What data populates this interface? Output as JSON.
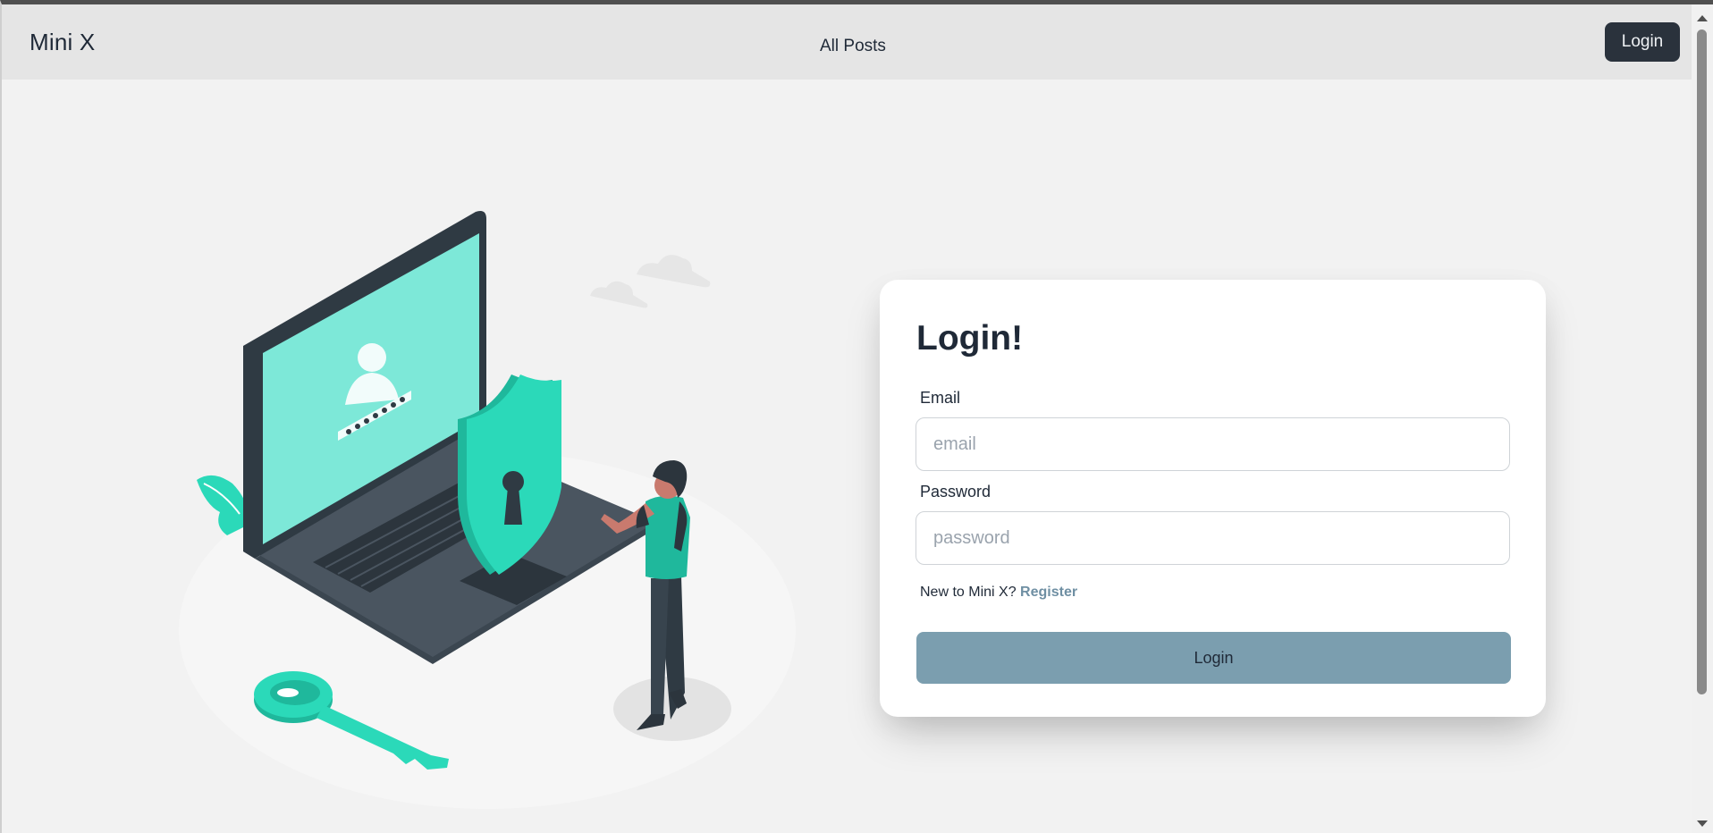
{
  "navbar": {
    "brand": "Mini X",
    "links": [
      {
        "label": "All Posts"
      }
    ],
    "login_label": "Login"
  },
  "illustration": {
    "icon": "security-login-illustration"
  },
  "login_card": {
    "title": "Login!",
    "email": {
      "label": "Email",
      "placeholder": "email",
      "value": ""
    },
    "password": {
      "label": "Password",
      "placeholder": "password",
      "value": ""
    },
    "register_prompt": "New to Mini X?",
    "register_link": "Register",
    "submit_label": "Login"
  },
  "colors": {
    "navbar_bg": "#e5e5e5",
    "page_bg": "#f2f2f2",
    "dark_button": "#2a323c",
    "primary_button": "#7b9eaf",
    "link": "#6f8fa3",
    "accent": "#2bd9b9"
  }
}
